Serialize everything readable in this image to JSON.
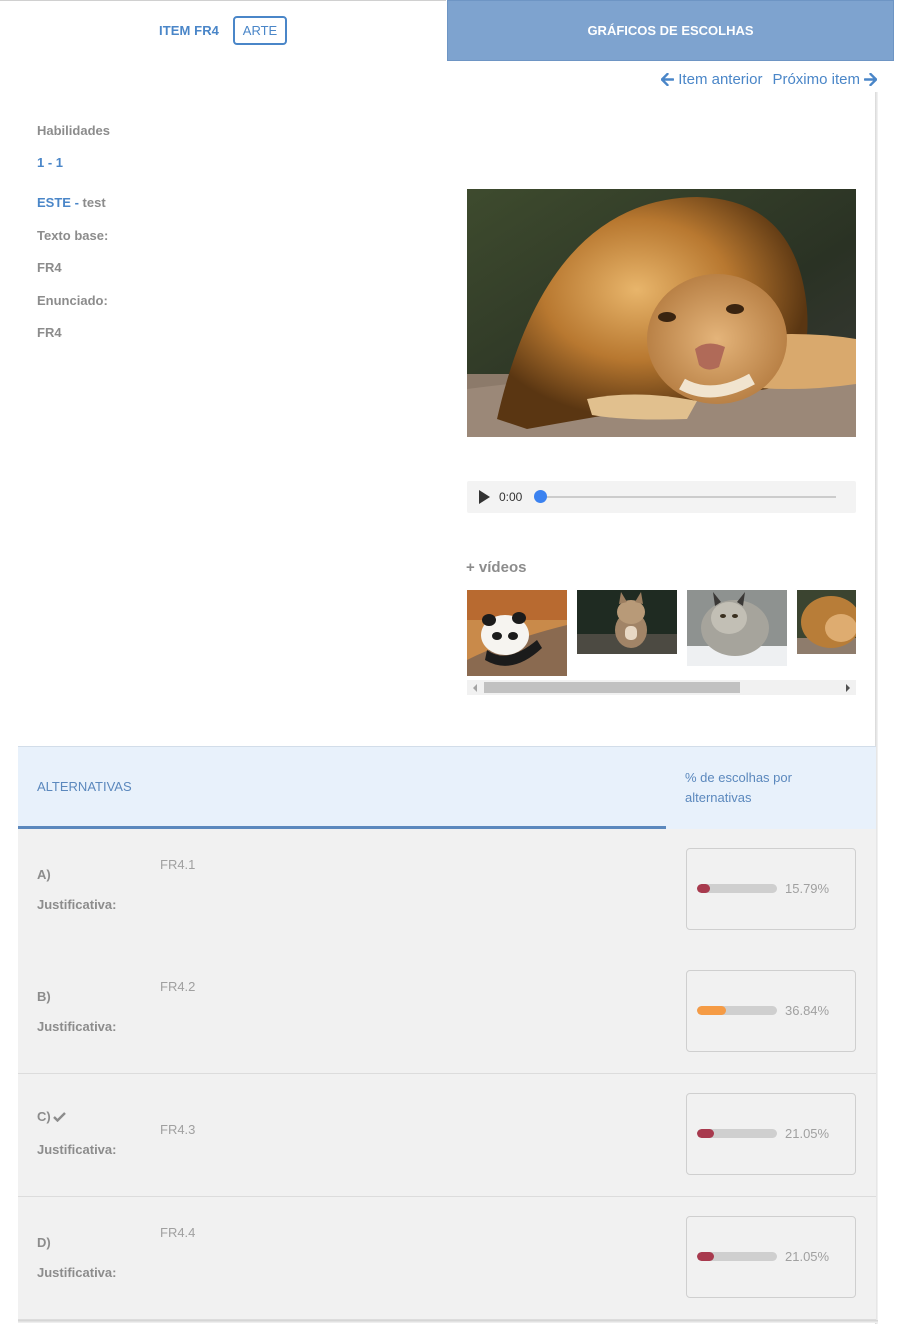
{
  "tabs": {
    "item_label": "ITEM FR4",
    "arte_label": "ARTE",
    "graficos_label": "GRÁFICOS DE ESCOLHAS"
  },
  "nav": {
    "prev_label": "Item anterior",
    "next_label": "Próximo item"
  },
  "info": {
    "habilidades_label": "Habilidades",
    "habilidades_value": "1 - 1",
    "este_code": "ESTE -",
    "este_name": "test",
    "texto_base_label": "Texto base:",
    "texto_base_value": "FR4",
    "enunciado_label": "Enunciado:",
    "enunciado_value": "FR4"
  },
  "media": {
    "audio_time": "0:00",
    "videos_title": "+ vídeos"
  },
  "alternatives": {
    "header_title": "ALTERNATIVAS",
    "header_pct": "% de escolhas por alternativas",
    "justificativa_label": "Justificativa:",
    "rows": [
      {
        "letter": "A)",
        "text": "FR4.1",
        "percent": "15.79%",
        "fraction": 0.1579,
        "color": "#a83a4e",
        "correct": false
      },
      {
        "letter": "B)",
        "text": "FR4.2",
        "percent": "36.84%",
        "fraction": 0.3684,
        "color": "#f59b45",
        "correct": false
      },
      {
        "letter": "C)",
        "text": "FR4.3",
        "percent": "21.05%",
        "fraction": 0.2105,
        "color": "#a83a4e",
        "correct": true
      },
      {
        "letter": "D)",
        "text": "FR4.4",
        "percent": "21.05%",
        "fraction": 0.2105,
        "color": "#a83a4e",
        "correct": false
      }
    ]
  },
  "colors": {
    "accent": "#4a86c8",
    "tab_active_bg": "#7ea3cf",
    "header_bg": "#e8f1fb"
  }
}
